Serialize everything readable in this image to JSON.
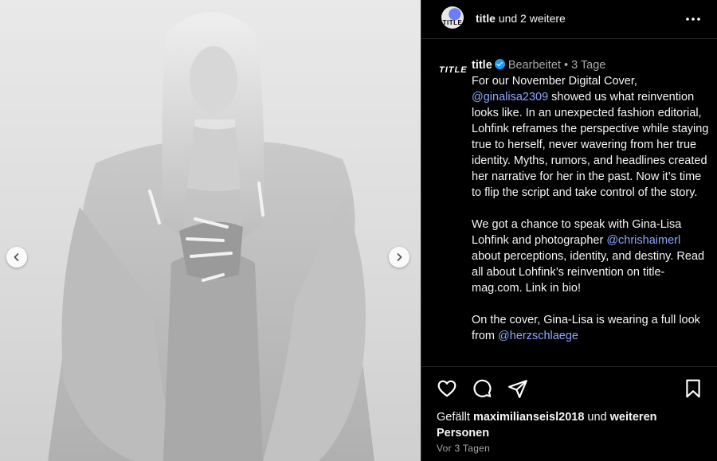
{
  "header": {
    "account": "title",
    "and_others": "und 2 weitere",
    "avatar_text": "TITLE"
  },
  "post": {
    "username": "title",
    "edited": "Bearbeitet",
    "dot": "•",
    "age": "3 Tage",
    "logo_text": "TITLE",
    "caption": {
      "p1_a": "For our November Digital Cover, ",
      "p1_mention": "@ginalisa2309",
      "p1_b": " showed us what reinvention looks like. In an unexpected fashion editorial, Lohfink reframes the perspective while staying true to herself, never wavering from her true identity. Myths, rumors, and headlines created her narrative for her in the past. Now it’s time to flip the script and take control of the story.",
      "p2_a": "We got a chance to speak with Gina-Lisa Lohfink and photographer ",
      "p2_mention": "@chrishaimerl",
      "p2_b": " about perceptions, identity, and destiny. Read all about Lohfink’s reinvention on title-mag.com. Link in bio!",
      "p3_a": "On the cover, Gina-Lisa is wearing a full look from ",
      "p3_mention": "@herzschlaege"
    }
  },
  "likes": {
    "prefix": "Gefällt ",
    "user": "maximilianseisl2018",
    "middle": " und ",
    "rest": "weiteren Personen"
  },
  "timestamp": "Vor 3 Tagen",
  "colors": {
    "background": "#000000",
    "mention": "#8ea8ff",
    "verified": "#1d9bf0",
    "muted": "#a8a8a8"
  },
  "icons": [
    "chevron-left-icon",
    "chevron-right-icon",
    "more-icon",
    "heart-icon",
    "comment-icon",
    "share-icon",
    "bookmark-icon",
    "verified-icon"
  ]
}
